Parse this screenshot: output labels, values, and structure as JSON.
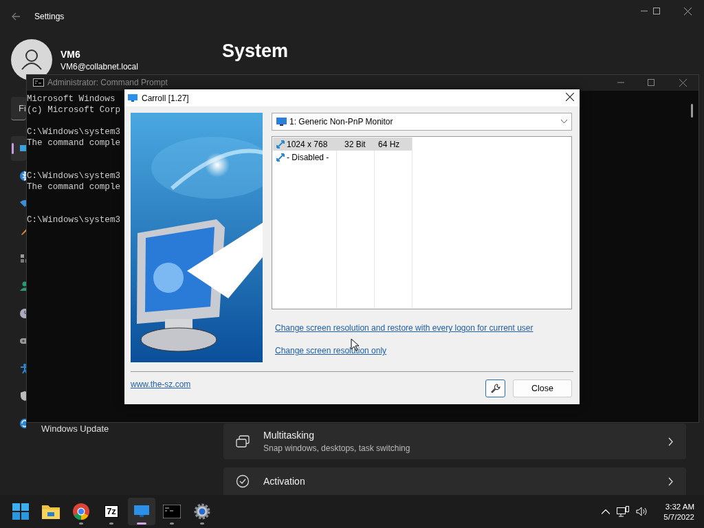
{
  "settings_window": {
    "title": "Settings",
    "user": {
      "name": "VM6",
      "email": "VM6@collabnet.local"
    },
    "search": {
      "placeholder": "Fi"
    },
    "page_title": "System",
    "sidebar": {
      "items": [
        {
          "selected": true
        },
        {
          "selected": false
        },
        {
          "selected": false
        },
        {
          "selected": false
        },
        {
          "selected": false
        },
        {
          "selected": false
        },
        {
          "selected": false
        },
        {
          "selected": false
        },
        {
          "selected": false
        },
        {
          "selected": false
        },
        {
          "selected": false,
          "label": "Windows Update"
        }
      ]
    },
    "cards": [
      {
        "title": "Multitasking",
        "description": "Snap windows, desktops, task switching"
      },
      {
        "title": "Activation"
      }
    ]
  },
  "console_window": {
    "title": "Administrator: Command Prompt",
    "active": false,
    "blocks": [
      [
        "Microsoft Windows",
        "(c) Microsoft Corp"
      ],
      [
        "C:\\Windows\\system3",
        "The command comple"
      ],
      [
        "C:\\Windows\\system3",
        "The command comple"
      ],
      [
        "C:\\Windows\\system3"
      ]
    ]
  },
  "dialog": {
    "title": "Carroll [1.27]",
    "monitor_select": {
      "value": "1: Generic Non-PnP Monitor"
    },
    "modes": {
      "rows": [
        {
          "resolution": "1024 x 768",
          "depth": "32 Bit",
          "frequency": "64 Hz",
          "selected": true
        },
        {
          "resolution": "- Disabled -",
          "selected": false
        }
      ]
    },
    "links": [
      "Change screen resolution and restore with every logon for current user",
      "Change screen resolution only"
    ],
    "website": "www.the-sz.com",
    "buttons": [
      {
        "kind": "icon"
      },
      {
        "kind": "text",
        "label": "Close"
      }
    ]
  },
  "taskbar": {
    "apps": [
      {
        "kind": "start",
        "running": false,
        "selected": false
      },
      {
        "kind": "folder",
        "running": false,
        "selected": false
      },
      {
        "kind": "browser",
        "running": true,
        "selected": false
      },
      {
        "kind": "archiver",
        "label": "7z",
        "running": true,
        "selected": false
      },
      {
        "kind": "monitor",
        "running": true,
        "selected": true
      },
      {
        "kind": "console",
        "running": true,
        "selected": false
      },
      {
        "kind": "settings",
        "running": true,
        "selected": false
      }
    ],
    "clock": {
      "time": "3:32 AM",
      "date": "5/7/2022"
    }
  }
}
